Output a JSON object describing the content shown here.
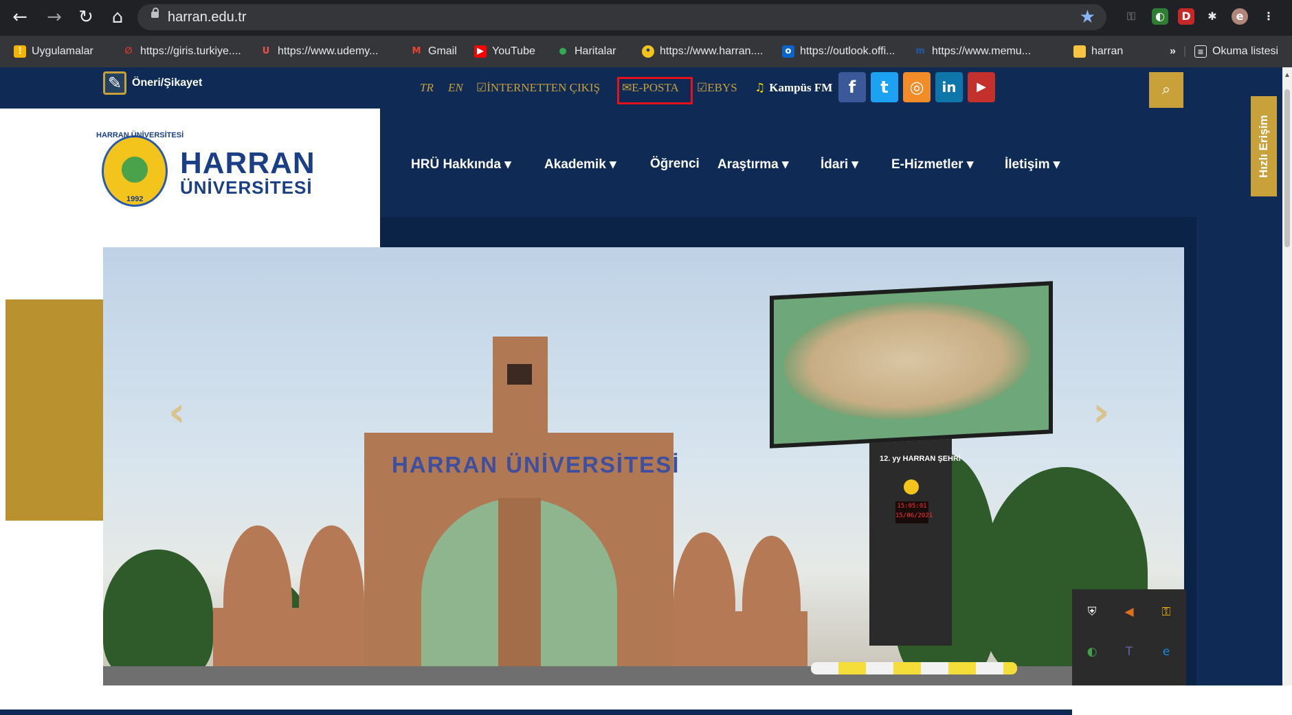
{
  "browser": {
    "url": "harran.edu.tr",
    "profile_initial": "e",
    "bookmarks": [
      {
        "label": "Uygulamalar",
        "icon": "apps-grid-icon",
        "color": "#f4b400"
      },
      {
        "label": "https://giris.turkiye....",
        "icon": "edevlet-icon",
        "color": "#e53935"
      },
      {
        "label": "https://www.udemy...",
        "icon": "udemy-icon",
        "color": "#ec5252"
      },
      {
        "label": "Gmail",
        "icon": "gmail-icon",
        "color": "#ea4335"
      },
      {
        "label": "YouTube",
        "icon": "youtube-icon",
        "color": "#ff0000"
      },
      {
        "label": "Haritalar",
        "icon": "maps-icon",
        "color": "#34a853"
      },
      {
        "label": "https://www.harran....",
        "icon": "harran-favicon-icon",
        "color": "#f3c41c"
      },
      {
        "label": "https://outlook.offi...",
        "icon": "outlook-icon",
        "color": "#0a64c9"
      },
      {
        "label": "https://www.memu...",
        "icon": "memurlar-icon",
        "color": "#1e5aa8"
      },
      {
        "label": "harran",
        "icon": "folder-icon",
        "color": "#f6c342"
      }
    ],
    "reading_list": "Okuma listesi",
    "overflow": "»"
  },
  "site": {
    "suggestion": "Öneri/Şikayet",
    "lang_tr": "TR",
    "lang_en": "EN",
    "internet_exit": "İNTERNETTEN ÇIKIŞ",
    "eposta": "E-POSTA",
    "ebys": "EBYS",
    "kampus_fm": "Kampüs FM",
    "social": [
      {
        "label": "f",
        "name": "facebook-icon",
        "color": "#3b5998"
      },
      {
        "label": "t",
        "name": "twitter-icon",
        "color": "#1da1f2"
      },
      {
        "label": "◎",
        "name": "instagram-icon",
        "color": "#f28c28"
      },
      {
        "label": "in",
        "name": "linkedin-icon",
        "color": "#0e76a8"
      },
      {
        "label": "▶",
        "name": "youtube-social-icon",
        "color": "#c4302b"
      }
    ],
    "quick_access": "Hızlı Erişim",
    "logo": {
      "line1": "HARRAN",
      "line2": "ÜNİVERSİTESİ",
      "seal_text": "HARRAN ÜNİVERSİTESİ",
      "seal_year": "1992"
    },
    "nav": [
      {
        "label": "HRÜ Hakkında",
        "has_dropdown": true
      },
      {
        "label": "Akademik",
        "has_dropdown": true
      },
      {
        "label": "Öğrenci",
        "has_dropdown": false
      },
      {
        "label": "Araştırma",
        "has_dropdown": true
      },
      {
        "label": "İdari",
        "has_dropdown": true
      },
      {
        "label": "E-Hizmetler",
        "has_dropdown": true
      },
      {
        "label": "İletişim",
        "has_dropdown": true
      }
    ],
    "dropdown_caret": "▾",
    "hero": {
      "gate_text": "HARRAN ÜNİVERSİTESİ",
      "sign_text": "12. yy HARRAN ŞEHRİ",
      "clock_time": "15:05:01",
      "clock_date": "15/06/2021",
      "prev": "‹",
      "next": "›"
    }
  },
  "colors": {
    "navy": "#0f2b55",
    "gold": "#c9a13a",
    "highlight": "#e3121b"
  }
}
